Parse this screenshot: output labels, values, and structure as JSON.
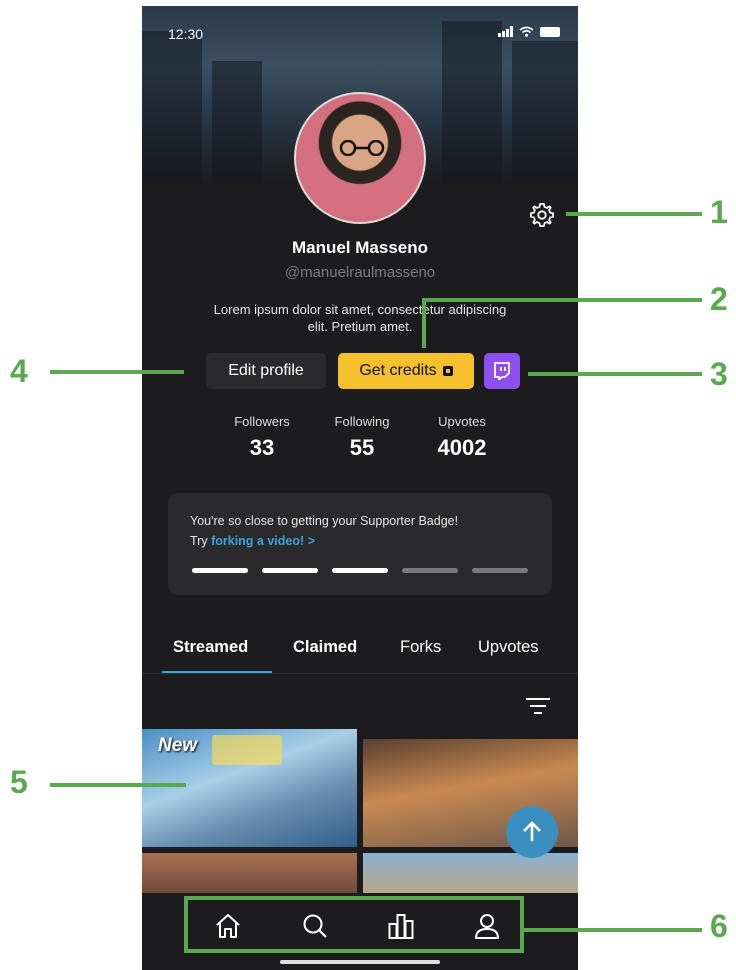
{
  "status": {
    "time": "12:30"
  },
  "profile": {
    "name": "Manuel Masseno",
    "handle": "@manuelraulmasseno",
    "bio": "Lorem ipsum dolor sit amet, consectetur adipiscing elit. Pretium amet."
  },
  "actions": {
    "edit_label": "Edit profile",
    "credits_label": "Get credits"
  },
  "stats": [
    {
      "label": "Followers",
      "value": "33"
    },
    {
      "label": "Following",
      "value": "55"
    },
    {
      "label": "Upvotes",
      "value": "4002"
    }
  ],
  "badge": {
    "line1": "You're  so close to getting your Supporter Badge!",
    "try": "Try",
    "link": "forking a video!",
    "chevron": ">",
    "progress_completed": 3,
    "progress_total": 5
  },
  "tabs": [
    {
      "label": "Streamed",
      "active": true
    },
    {
      "label": "Claimed",
      "active": false
    },
    {
      "label": "Forks",
      "active": false
    },
    {
      "label": "Upvotes",
      "active": false
    }
  ],
  "grid": {
    "new_label": "New"
  },
  "nav": {
    "icons": [
      "home-icon",
      "search-icon",
      "leaderboard-icon",
      "profile-icon"
    ]
  },
  "annotations": {
    "n1": "1",
    "n2": "2",
    "n3": "3",
    "n4": "4",
    "n5": "5",
    "n6": "6"
  },
  "colors": {
    "accent": "#3aa3d8",
    "credits": "#f5c02c",
    "twitch": "#8e4ff0",
    "annotation": "#5aa84f",
    "background": "#1c1c1e"
  }
}
